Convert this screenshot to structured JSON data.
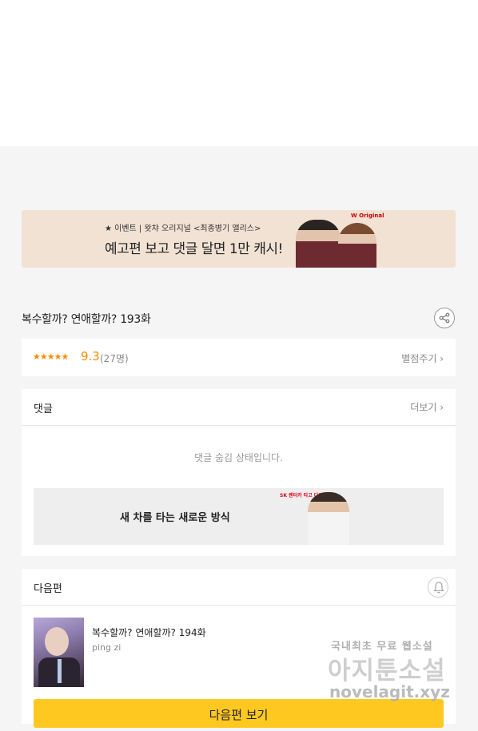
{
  "banner": {
    "small": "★ 이벤트 | 왓챠 오리지널 <최종병기 앨리스>",
    "big": "예고편 보고 댓글 달면 1만 캐시!",
    "logo": "W Original"
  },
  "episode": {
    "title": "복수할까? 연애할까? 193화"
  },
  "rating": {
    "stars": "★★★★★",
    "score": "9.3",
    "count": "(27명)",
    "rate_link": "별점주기 ›"
  },
  "comments": {
    "label": "댓글",
    "more": "더보기 ›",
    "hidden_message": "댓글 숨김 상태입니다.",
    "ad_text": "새 차를 타는 새로운 방식",
    "ad_brand": "SK 렌터카 타고 다이렉트"
  },
  "next": {
    "label": "다음편",
    "title": "복수할까? 연애할까? 194화",
    "author": "ping zi",
    "button": "다음편 보기"
  },
  "watermark": {
    "line1": "국내최초 무료 웹소설",
    "line2": "아지툰소설",
    "line3": "novelagit.xyz"
  },
  "colors": {
    "accent": "#ffc821",
    "star": "#ff8a00",
    "background": "#f5f5f5"
  },
  "icons": [
    "share-icon",
    "bell-icon",
    "chevron-right-icon"
  ]
}
